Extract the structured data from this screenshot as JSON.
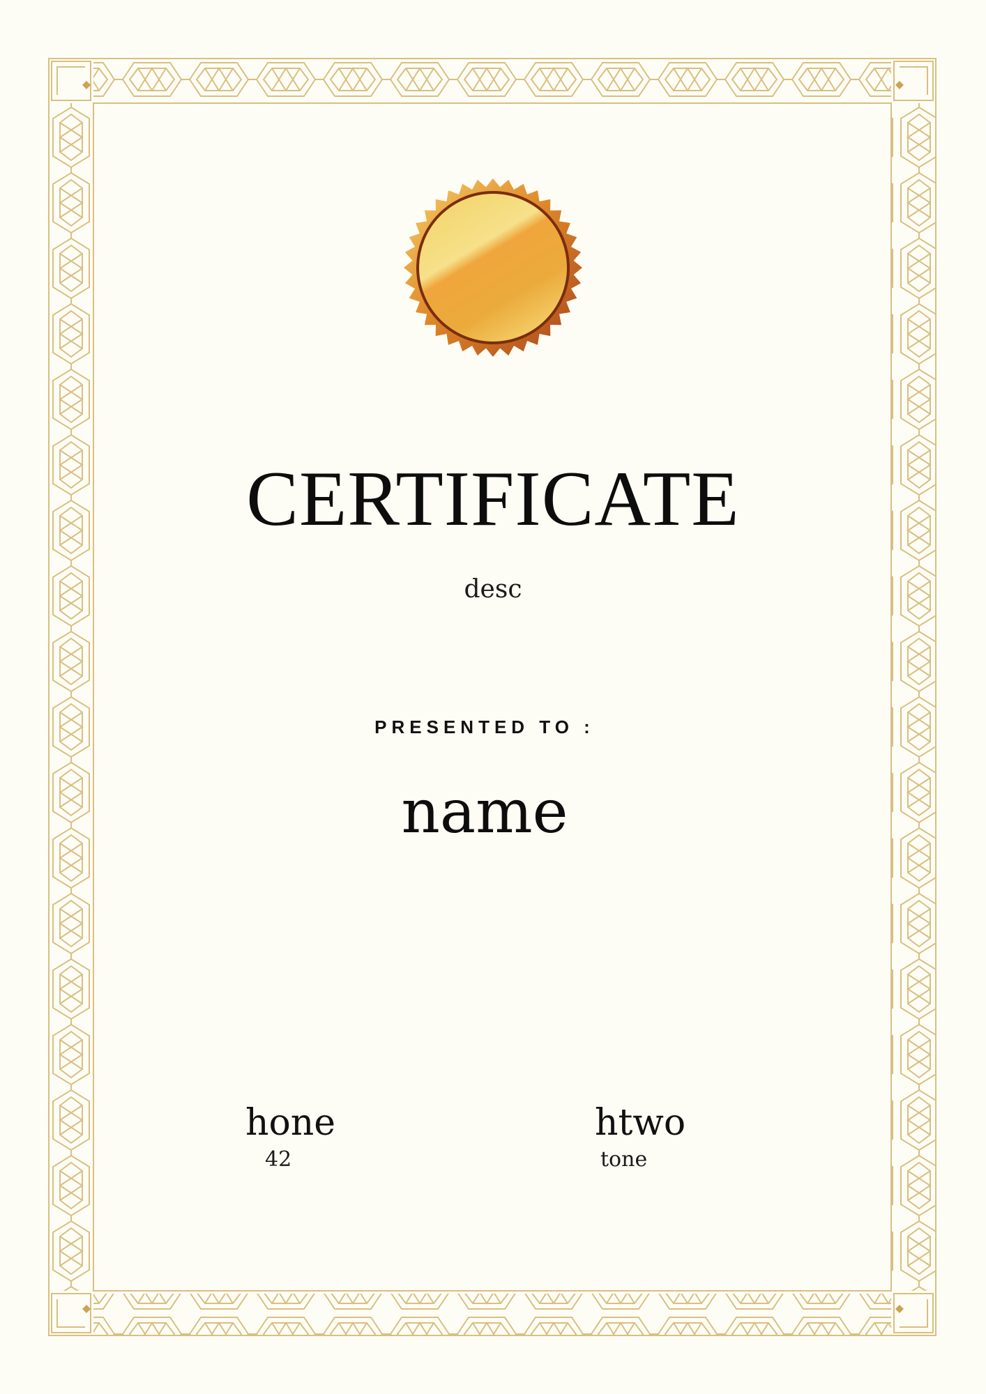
{
  "certificate": {
    "title": "CERTIFICATE",
    "description": "desc",
    "presented_label": "PRESENTED TO :",
    "recipient_name": "name"
  },
  "signatures": {
    "left": {
      "heading": "hone",
      "subtext": "42"
    },
    "right": {
      "heading": "htwo",
      "subtext": "tone"
    }
  },
  "colors": {
    "background": "#fefdf5",
    "border_gold": "#d8bf82",
    "seal_gold": "#f0a83a",
    "seal_rim": "#c4621a",
    "text": "#111111"
  },
  "icons": {
    "seal": "gold-seal-icon",
    "border": "ornamental-border"
  }
}
